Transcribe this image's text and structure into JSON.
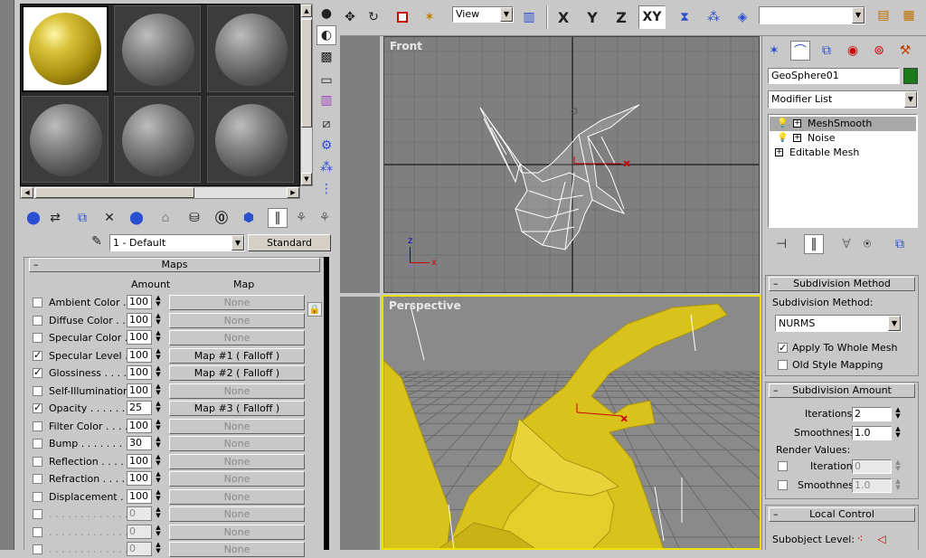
{
  "toolbar": {
    "view_dropdown": "View",
    "axis_x": "X",
    "axis_y": "Y",
    "axis_z": "Z",
    "axis_xy": "XY",
    "named_selection": ""
  },
  "material_editor": {
    "material_name": "1 - Default",
    "material_type": "Standard",
    "maps_header": "Maps",
    "col_amount": "Amount",
    "col_map": "Map",
    "maps": [
      {
        "label": "Ambient Color . . .",
        "checked": false,
        "amount": "100",
        "map": "None",
        "enabled": true
      },
      {
        "label": "Diffuse Color . . .",
        "checked": false,
        "amount": "100",
        "map": "None",
        "enabled": true
      },
      {
        "label": "Specular Color . .",
        "checked": false,
        "amount": "100",
        "map": "None",
        "enabled": true
      },
      {
        "label": "Specular Level . .",
        "checked": true,
        "amount": "100",
        "map": "Map #1  ( Falloff )",
        "enabled": true
      },
      {
        "label": "Glossiness . . . . .",
        "checked": true,
        "amount": "100",
        "map": "Map #2  ( Falloff )",
        "enabled": true
      },
      {
        "label": "Self-Illumination .",
        "checked": false,
        "amount": "100",
        "map": "None",
        "enabled": true
      },
      {
        "label": "Opacity . . . . . . .",
        "checked": true,
        "amount": "25",
        "map": "Map #3  ( Falloff )",
        "enabled": true
      },
      {
        "label": "Filter Color . . . .",
        "checked": false,
        "amount": "100",
        "map": "None",
        "enabled": true
      },
      {
        "label": "Bump . . . . . . . .",
        "checked": false,
        "amount": "30",
        "map": "None",
        "enabled": true
      },
      {
        "label": "Reflection . . . . .",
        "checked": false,
        "amount": "100",
        "map": "None",
        "enabled": true
      },
      {
        "label": "Refraction . . . . .",
        "checked": false,
        "amount": "100",
        "map": "None",
        "enabled": true
      },
      {
        "label": "Displacement . .",
        "checked": false,
        "amount": "100",
        "map": "None",
        "enabled": true
      },
      {
        "label": ". . . . . . . . . . . . .",
        "checked": false,
        "amount": "0",
        "map": "None",
        "enabled": false
      },
      {
        "label": ". . . . . . . . . . . . .",
        "checked": false,
        "amount": "0",
        "map": "None",
        "enabled": false
      },
      {
        "label": ". . . . . . . . . . . . .",
        "checked": false,
        "amount": "0",
        "map": "None",
        "enabled": false
      }
    ]
  },
  "viewports": {
    "front_label": "Front",
    "perspective_label": "Perspective",
    "axis_z": "z",
    "axis_x": "x"
  },
  "command_panel": {
    "object_name": "GeoSphere01",
    "object_color": "#1a7a1a",
    "modifier_list": "Modifier List",
    "stack": [
      {
        "label": "MeshSmooth",
        "selected": true
      },
      {
        "label": "Noise",
        "selected": false
      },
      {
        "label": "Editable Mesh",
        "selected": false
      }
    ],
    "subdivision_method_header": "Subdivision Method",
    "subdivision_method_label": "Subdivision Method:",
    "subdivision_method_value": "NURMS",
    "apply_whole_mesh": "Apply To Whole Mesh",
    "apply_whole_mesh_checked": true,
    "old_style_mapping": "Old Style Mapping",
    "old_style_mapping_checked": false,
    "subdivision_amount_header": "Subdivision Amount",
    "iterations_label": "Iterations:",
    "iterations_value": "2",
    "smoothness_label": "Smoothness:",
    "smoothness_value": "1.0",
    "render_values_label": "Render Values:",
    "render_iterations_label": "Iterations:",
    "render_iterations_value": "0",
    "render_smoothness_label": "Smoothness:",
    "render_smoothness_value": "1.0",
    "local_control_header": "Local Control",
    "subobject_level_label": "Subobject Level:"
  }
}
